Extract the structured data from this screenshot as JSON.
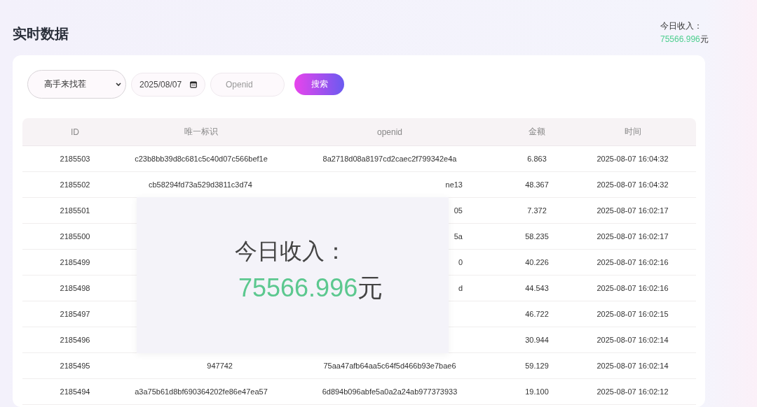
{
  "header": {
    "title": "实时数据",
    "income": {
      "label": "今日收入：",
      "amount": "75566.996",
      "unit": "元"
    }
  },
  "filters": {
    "select": {
      "value": "高手来找茬"
    },
    "date": {
      "value": "2025/08/07"
    },
    "openid": {
      "placeholder": "Openid"
    },
    "search_button": "搜索"
  },
  "table": {
    "columns": [
      "ID",
      "唯一标识",
      "openid",
      "金额",
      "时间"
    ],
    "rows": [
      {
        "cells": [
          {
            "kind": "full",
            "text": "2185503"
          },
          {
            "kind": "full",
            "text": "c23b8bb39d8c681c5c40d07c566bef1e"
          },
          {
            "kind": "full",
            "text": "8a2718d08a8197cd2caec2f799342e4a"
          },
          {
            "kind": "full",
            "text": "6.863"
          },
          {
            "kind": "full",
            "text": "2025-08-07 16:04:32"
          }
        ]
      },
      {
        "cells": [
          {
            "kind": "full",
            "text": "2185502"
          },
          {
            "kind": "head",
            "text": "cb58294fd73a529d3811c3d74"
          },
          {
            "kind": "tail",
            "text": "ne13"
          },
          {
            "kind": "full",
            "text": "48.367"
          },
          {
            "kind": "full",
            "text": "2025-08-07 16:04:32"
          }
        ]
      },
      {
        "cells": [
          {
            "kind": "full",
            "text": "2185501"
          },
          {
            "kind": "hidden"
          },
          {
            "kind": "tail",
            "text": "05"
          },
          {
            "kind": "full",
            "text": "7.372"
          },
          {
            "kind": "full",
            "text": "2025-08-07 16:02:17"
          }
        ]
      },
      {
        "cells": [
          {
            "kind": "full",
            "text": "2185500"
          },
          {
            "kind": "hidden"
          },
          {
            "kind": "tail",
            "text": "5a"
          },
          {
            "kind": "full",
            "text": "58.235"
          },
          {
            "kind": "full",
            "text": "2025-08-07 16:02:17"
          }
        ]
      },
      {
        "cells": [
          {
            "kind": "full",
            "text": "2185499"
          },
          {
            "kind": "hidden"
          },
          {
            "kind": "tail",
            "text": "0"
          },
          {
            "kind": "full",
            "text": "40.226"
          },
          {
            "kind": "full",
            "text": "2025-08-07 16:02:16"
          }
        ]
      },
      {
        "cells": [
          {
            "kind": "full",
            "text": "2185498"
          },
          {
            "kind": "hidden"
          },
          {
            "kind": "tail",
            "text": "d"
          },
          {
            "kind": "full",
            "text": "44.543"
          },
          {
            "kind": "full",
            "text": "2025-08-07 16:02:16"
          }
        ]
      },
      {
        "cells": [
          {
            "kind": "full",
            "text": "2185497"
          },
          {
            "kind": "hidden"
          },
          {
            "kind": "hidden"
          },
          {
            "kind": "full",
            "text": "46.722"
          },
          {
            "kind": "full",
            "text": "2025-08-07 16:02:15"
          }
        ]
      },
      {
        "cells": [
          {
            "kind": "full",
            "text": "2185496"
          },
          {
            "kind": "hidden"
          },
          {
            "kind": "hidden"
          },
          {
            "kind": "full",
            "text": "30.944"
          },
          {
            "kind": "full",
            "text": "2025-08-07 16:02:14"
          }
        ]
      },
      {
        "cells": [
          {
            "kind": "full",
            "text": "2185495"
          },
          {
            "kind": "tail",
            "text": "947742"
          },
          {
            "kind": "full",
            "text": "75aa47afb64aa5c64f5d466b93e7bae6"
          },
          {
            "kind": "full",
            "text": "59.129"
          },
          {
            "kind": "full",
            "text": "2025-08-07 16:02:14"
          }
        ]
      },
      {
        "cells": [
          {
            "kind": "full",
            "text": "2185494"
          },
          {
            "kind": "full",
            "text": "a3a75b61d8bf690364202fe86e47ea57"
          },
          {
            "kind": "full",
            "text": "6d894b096abfe5a0a2a24ab977373933"
          },
          {
            "kind": "full",
            "text": "19.100"
          },
          {
            "kind": "full",
            "text": "2025-08-07 16:02:12"
          }
        ]
      }
    ]
  },
  "zoom_callout": {
    "label": "今日收入：",
    "amount": "75566.996",
    "unit": "元"
  }
}
